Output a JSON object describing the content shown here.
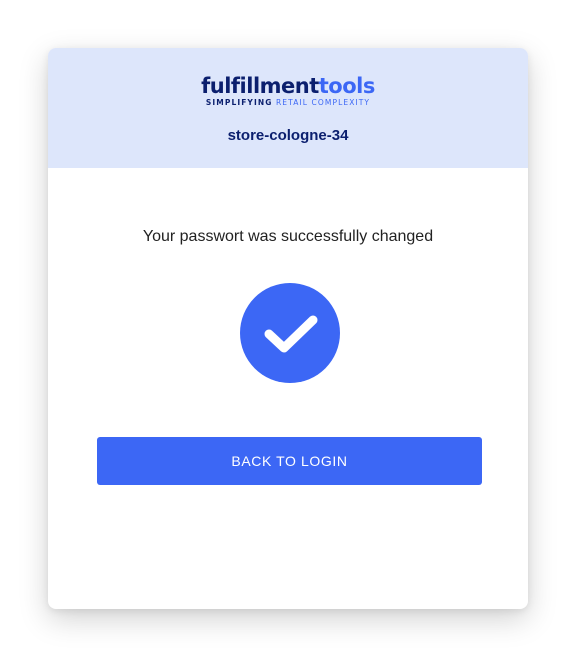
{
  "brand": {
    "logo_main": "fulfillment",
    "logo_accent": "tools",
    "tagline_main": "SIMPLIFYING",
    "tagline_accent": "RETAIL COMPLEXITY"
  },
  "store": {
    "name": "store-cologne-34"
  },
  "confirmation": {
    "message": "Your passwort was successfully changed",
    "status_icon": "check-circle-icon"
  },
  "actions": {
    "back_label": "BACK TO LOGIN"
  },
  "colors": {
    "primary": "#3c67f5",
    "brand_dark": "#0b1f6e",
    "header_bg": "#dde6fb"
  }
}
